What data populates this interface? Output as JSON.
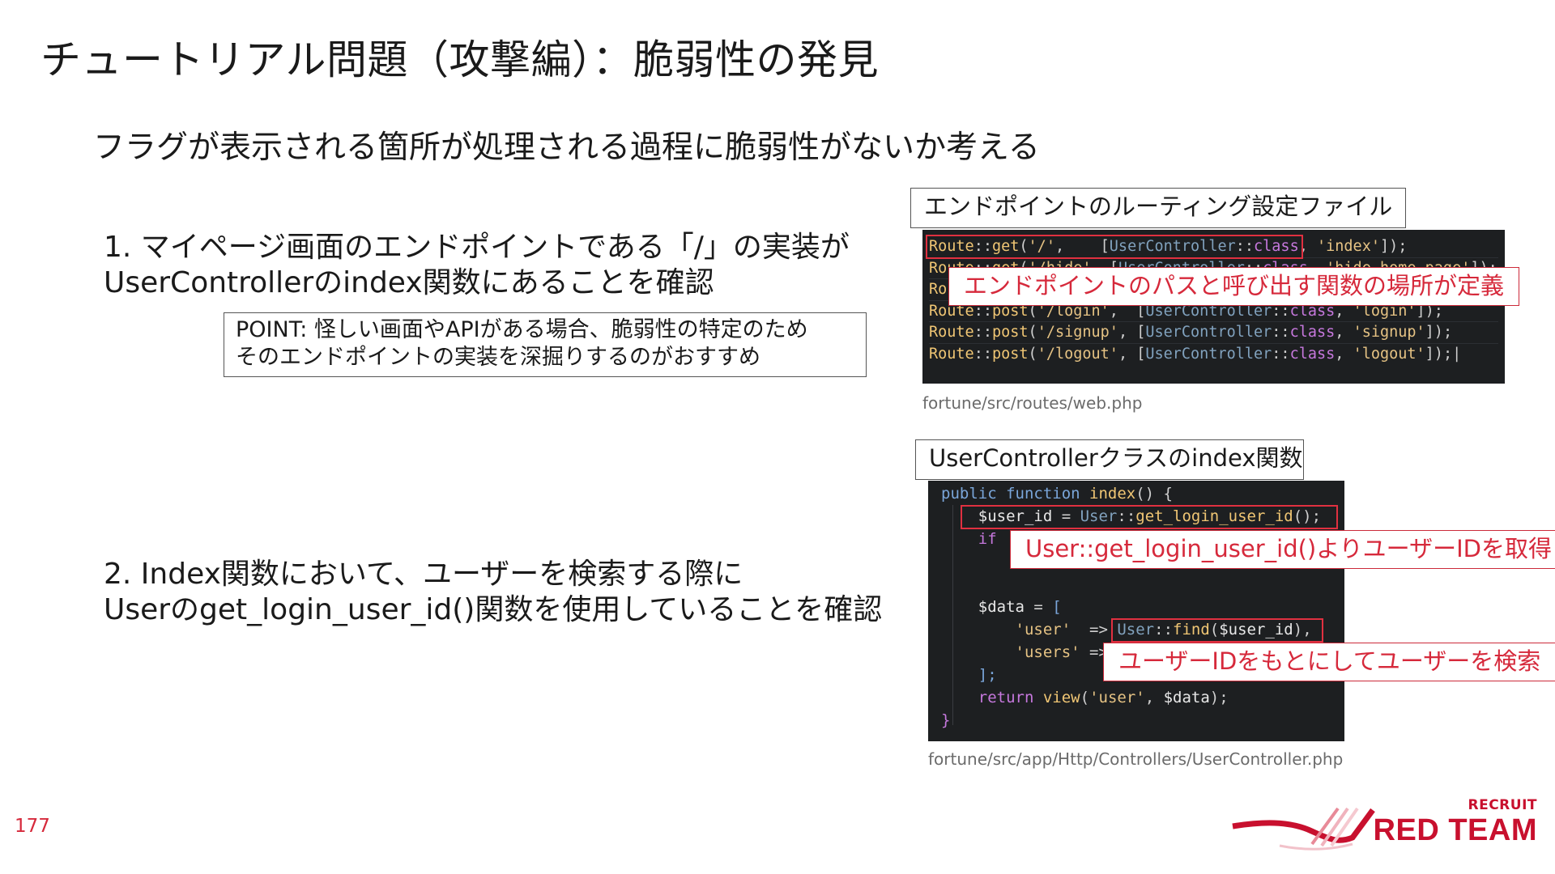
{
  "slide": {
    "title": "チュートリアル問題（攻撃編）：脆弱性の発見",
    "subtitle": "フラグが表示される箇所が処理される過程に脆弱性がないか考える",
    "page_number": "177"
  },
  "steps": [
    {
      "line1": "1. マイページ画面のエンドポイントである「/」の実装が",
      "line2": "UserControllerのindex関数にあることを確認"
    },
    {
      "line1": "2. Index関数において、ユーザーを検索する際に",
      "line2": "Userのget_login_user_id()関数を使用していることを確認"
    }
  ],
  "point_box": {
    "line1": "POINT: 怪しい画面やAPIがある場合、脆弱性の特定のため",
    "line2": "そのエンドポイントの実装を深掘りするのがおすすめ"
  },
  "routes_panel": {
    "label": "エンドポイントのルーティング設定ファイル",
    "callout": "エンドポイントのパスと呼び出す関数の場所が定義",
    "caption": "fortune/src/routes/web.php",
    "code_lines": [
      "Route::get('/',    [UserController::class, 'index']);",
      "Route::get('/hide', [UserController::class, 'hide_home_page']);",
      "Route::get('/login', [UserController::class, 'login_form']);",
      "Route::post('/login',  [UserController::class, 'login']);",
      "Route::post('/signup', [UserController::class, 'signup']);",
      "Route::post('/logout', [UserController::class, 'logout']);"
    ]
  },
  "controller_panel": {
    "label": "UserControllerクラスのindex関数",
    "callout_1": "User::get_login_user_id()よりユーザーIDを取得",
    "callout_2": "ユーザーIDをもとにしてユーザーを検索",
    "caption": "fortune/src/app/Http/Controllers/UserController.php",
    "code_lines": [
      "public function index() {",
      "    $user_id = User::get_login_user_id();",
      "    if",
      "",
      "",
      "    $data = [",
      "        'user'  => User::find($user_id),",
      "        'users' =>",
      "    ];",
      "    return view('user', $data);",
      "}"
    ]
  },
  "logo": {
    "small": "RECRUIT",
    "big": "RED TEAM"
  },
  "colors": {
    "accent": "#d6293b",
    "code_bg": "#1d1f21",
    "highlight": "#e03040"
  }
}
